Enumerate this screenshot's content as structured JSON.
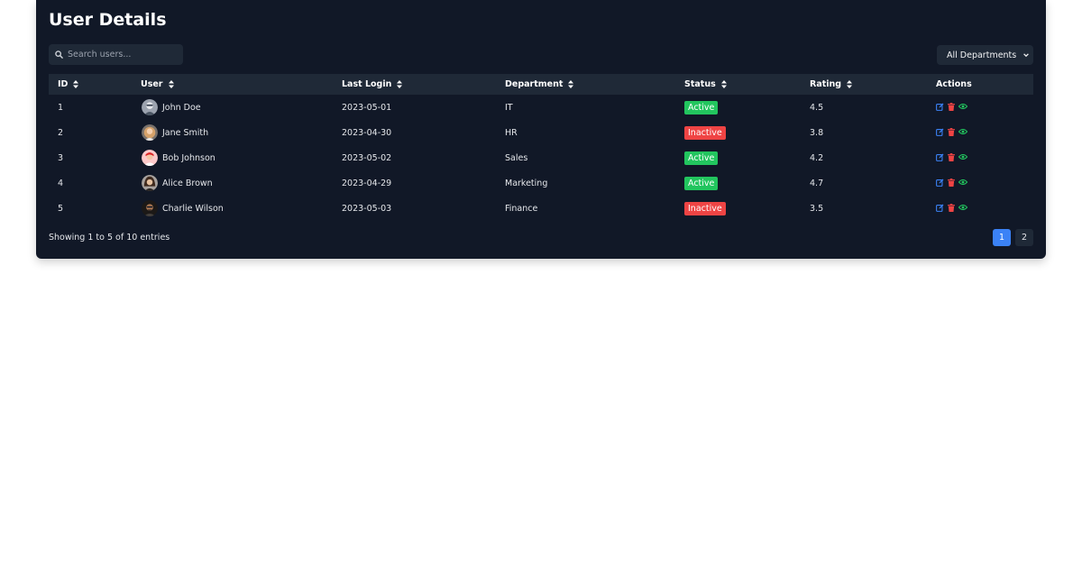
{
  "title": "User Details",
  "search": {
    "placeholder": "Search users..."
  },
  "department_filter": {
    "selected": "All Departments"
  },
  "columns": [
    {
      "label": "ID",
      "sortable": true
    },
    {
      "label": "User",
      "sortable": true
    },
    {
      "label": "Last Login",
      "sortable": true
    },
    {
      "label": "Department",
      "sortable": true
    },
    {
      "label": "Status",
      "sortable": true
    },
    {
      "label": "Rating",
      "sortable": true
    },
    {
      "label": "Actions",
      "sortable": false
    }
  ],
  "rows": [
    {
      "id": "1",
      "name": "John Doe",
      "last_login": "2023-05-01",
      "department": "IT",
      "status": "Active",
      "rating": "4.5"
    },
    {
      "id": "2",
      "name": "Jane Smith",
      "last_login": "2023-04-30",
      "department": "HR",
      "status": "Inactive",
      "rating": "3.8"
    },
    {
      "id": "3",
      "name": "Bob Johnson",
      "last_login": "2023-05-02",
      "department": "Sales",
      "status": "Active",
      "rating": "4.2"
    },
    {
      "id": "4",
      "name": "Alice Brown",
      "last_login": "2023-04-29",
      "department": "Marketing",
      "status": "Active",
      "rating": "4.7"
    },
    {
      "id": "5",
      "name": "Charlie Wilson",
      "last_login": "2023-05-03",
      "department": "Finance",
      "status": "Inactive",
      "rating": "3.5"
    }
  ],
  "footer": {
    "summary": "Showing 1 to 5 of 10 entries"
  },
  "pagination": {
    "pages": [
      "1",
      "2"
    ],
    "current": "1"
  },
  "colors": {
    "card_bg": "#111827",
    "header_bg": "#1f2937",
    "active": "#22c55e",
    "inactive": "#ef4444",
    "edit_icon": "#3b82f6",
    "delete_icon": "#ef4444",
    "view_icon": "#22c55e",
    "page_current": "#3b82f6"
  },
  "icons": {
    "search": "search-icon",
    "sort": "sort-icon",
    "dropdown": "chevron-down-icon",
    "edit": "edit-icon",
    "delete": "trash-icon",
    "view": "eye-icon"
  }
}
